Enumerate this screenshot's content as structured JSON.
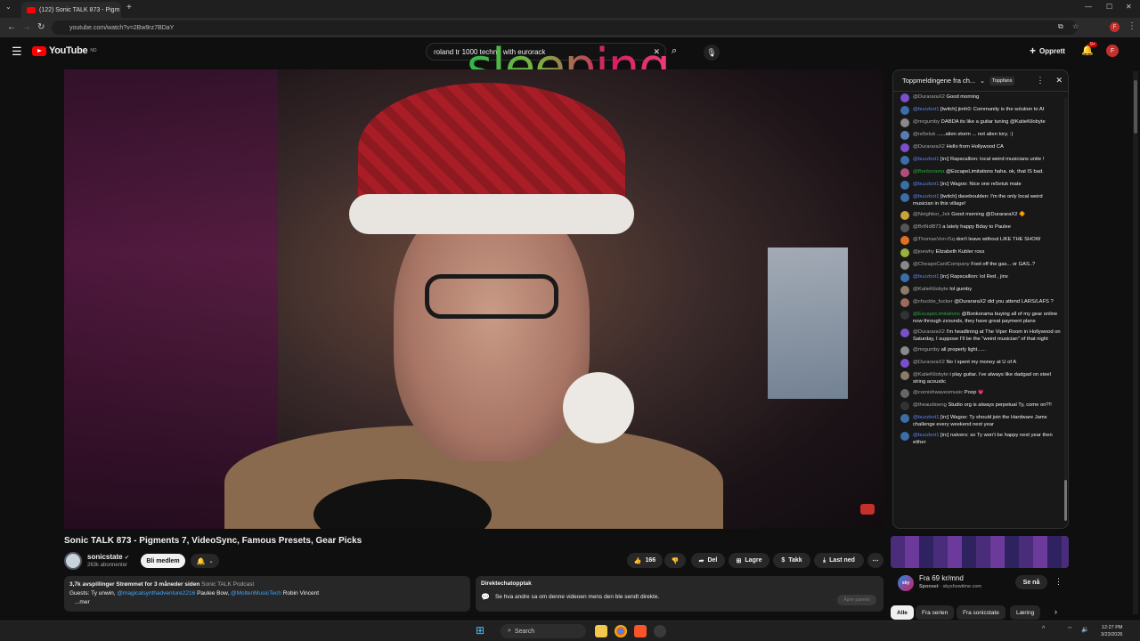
{
  "browser": {
    "tab_title": "(122) Sonic TALK 873 - Pigm",
    "url": "youtube.com/watch?v=2Bw9rz7BDaY"
  },
  "header": {
    "logo_text": "YouTube",
    "logo_region": "NO",
    "search_query": "roland tr 1000 techno with eurorack",
    "overlay_word": "sleeping",
    "create_label": "Opprett",
    "notif_count": "9+",
    "avatar_letter": "F"
  },
  "video": {
    "title": "Sonic TALK 873 - Pigments 7, VideoSync, Famous Presets, Gear Picks",
    "channel_name": "sonicstate",
    "subscribers": "263k abonnenter",
    "member_button": "Bli medlem",
    "likes": "166",
    "share": "Del",
    "save": "Lagre",
    "thanks": "Takk",
    "download": "Last ned"
  },
  "description": {
    "stats": "3,7k avspillinger  Strømmet for 3 måneder siden",
    "podcast": "Sonic TALK Podcast",
    "guests_prefix": "Guests: Ty unwin,",
    "guest_link1": "@magicalsynthadventure2216",
    "guest_plain": "Paulee Bow,",
    "guest_link2": "@MoltenMusicTech",
    "guest_last": "Robin Vincent",
    "more": "...mer"
  },
  "replay": {
    "heading": "Direktechatopptak",
    "text": "Se hva andre sa om denne videoen mens den ble sendt direkte.",
    "button": "Åpne panelet"
  },
  "chat": {
    "title": "Toppmeldingene fra ch...",
    "topfans": "Toppfans",
    "messages": [
      {
        "author": "@DurararaX2",
        "text": "Good morning",
        "color": "#7b4fc9",
        "cls": "author"
      },
      {
        "author": "@buzzbot1",
        "text": "[twitch] jimh0: Community is the solution to AI",
        "color": "#3b6ea8",
        "cls": "author blue"
      },
      {
        "author": "@mrgumby",
        "text": "DABDA its like a guitar tuning @KatieKilobyte",
        "color": "#8a8a8a",
        "cls": "author"
      },
      {
        "author": "@re5etuk",
        "text": "......alien storm ... not alien tory. :)",
        "color": "#5a7bb5",
        "cls": "author"
      },
      {
        "author": "@DurararaX2",
        "text": "Hello from Hollywood CA",
        "color": "#7b4fc9",
        "cls": "author"
      },
      {
        "author": "@buzzbot1",
        "text": "[irc] Rapscallion: local weird musicians unite !",
        "color": "#3b6ea8",
        "cls": "author blue"
      },
      {
        "author": "@Bonkorama",
        "text": "@EscapeLimitations haha. ok, that IS bad.",
        "color": "#b0507a",
        "cls": "author green"
      },
      {
        "author": "@buzzbot1",
        "text": "[irc] Wagoo: Nice one re5etuk mate",
        "color": "#3b6ea8",
        "cls": "author blue"
      },
      {
        "author": "@buzzbot1",
        "text": "[twitch] daveboulden: I'm the only local weird musician in this village!",
        "color": "#3b6ea8",
        "cls": "author blue"
      },
      {
        "author": "@Neighbor_Jek",
        "text": "Good morning @DurararaX2 🔶",
        "color": "#c9a23a",
        "cls": "author"
      },
      {
        "author": "@BrtNdl873",
        "text": "a lately happy Bday to Paulee",
        "color": "#555",
        "cls": "author"
      },
      {
        "author": "@ThomasVon-f1q",
        "text": "don't leave without LIKE THE SHOW",
        "color": "#e07020",
        "cls": "author"
      },
      {
        "author": "@joewhy",
        "text": "Elizabeth Kubler ross",
        "color": "#9ab040",
        "cls": "author"
      },
      {
        "author": "@CheapoCardCompany",
        "text": "Foot off the gas... or GAS..?",
        "color": "#888",
        "cls": "author"
      },
      {
        "author": "@buzzbot1",
        "text": "[irc] Rapscallion: lol Red , jinx",
        "color": "#3b6ea8",
        "cls": "author blue"
      },
      {
        "author": "@KatieKilobyte",
        "text": "lol gumby",
        "color": "#8c7a6a",
        "cls": "author"
      },
      {
        "author": "@chuckle_fucker",
        "text": "@DurararaX2 did you attend LARS/LAFS ?",
        "color": "#9a6a5a",
        "cls": "author"
      },
      {
        "author": "@EscapeLimitations",
        "text": "@Bonkorama buying all of my gear online now through zzounds, they have great payment plans",
        "color": "#333",
        "cls": "author green"
      },
      {
        "author": "@DurararaX2",
        "text": "I'm headlining at The Viper Room in Hollywood on Saturday, I suppose I'll be the \"weird musician\" of that night",
        "color": "#7b4fc9",
        "cls": "author"
      },
      {
        "author": "@mrgumby",
        "text": "all properly light......",
        "color": "#8a8a8a",
        "cls": "author"
      },
      {
        "author": "@DurararaX2",
        "text": "No I spent my money at U of A",
        "color": "#7b4fc9",
        "cls": "author"
      },
      {
        "author": "@KatieKilobyte",
        "text": "i play guitar. i've always like dadgad on steel string acoustic",
        "color": "#8c7a6a",
        "cls": "author"
      },
      {
        "author": "@cornishwavesmusic",
        "text": "Poop 💗",
        "color": "#666",
        "cls": "author"
      },
      {
        "author": "@theaudioeng",
        "text": "Studio org is always perpetual Ty, come on?!!",
        "color": "#333",
        "cls": "author"
      },
      {
        "author": "@buzzbot1",
        "text": "[irc] Wagoo: Ty should join the Hardware Jams challenge every weekend next year",
        "color": "#3b6ea8",
        "cls": "author blue"
      },
      {
        "author": "@buzzbot1",
        "text": "[irc] natvers: so Ty won't be happy next year then either",
        "color": "#3b6ea8",
        "cls": "author blue"
      }
    ]
  },
  "ad": {
    "logo": "sky",
    "title": "Fra 69 kr/mnd",
    "sponsor": "Sponset",
    "domain": "skyshowtime.com",
    "button": "Se nå"
  },
  "chips": [
    "Alle",
    "Fra serien",
    "Fra sonicstate",
    "Læring"
  ],
  "taskbar": {
    "search": "Search",
    "time": "12:27 PM",
    "date": "3/23/2026"
  }
}
